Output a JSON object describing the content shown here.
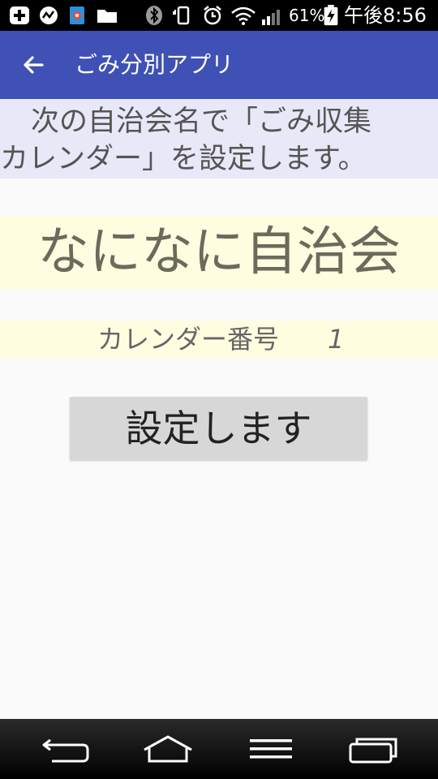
{
  "status_bar": {
    "battery_percent": "61%",
    "clock": "午後8:56",
    "icons": [
      "plus-box-icon",
      "speed-icon",
      "app-shortcut-icon",
      "folder-icon",
      "bluetooth-icon",
      "vibrate-icon",
      "alarm-icon",
      "wifi-icon",
      "signal-icon",
      "battery-charging-icon"
    ]
  },
  "app_bar": {
    "title": "ごみ分別アプリ",
    "back_icon": "arrow-back-icon",
    "color": "#3f51b5"
  },
  "instruction": {
    "line1": "次の自治会名で「ごみ収集",
    "line2": "カレンダー」を設定します。"
  },
  "association_name": "なになに自治会",
  "calendar": {
    "label": "カレンダー番号",
    "number": "1"
  },
  "set_button": {
    "label": "設定します"
  },
  "nav_bar": {
    "icons": [
      "back-icon",
      "home-icon",
      "menu-icon",
      "recent-apps-icon"
    ]
  }
}
